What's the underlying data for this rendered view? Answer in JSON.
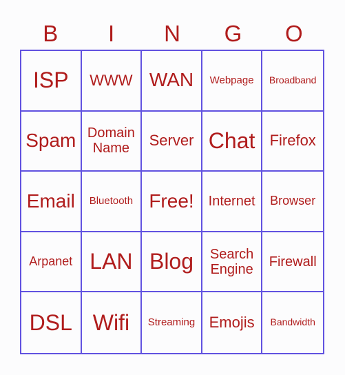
{
  "header": [
    "B",
    "I",
    "N",
    "G",
    "O"
  ],
  "cells": [
    [
      "ISP",
      "WWW",
      "WAN",
      "Webpage",
      "Broadband"
    ],
    [
      "Spam",
      "Domain Name",
      "Server",
      "Chat",
      "Firefox"
    ],
    [
      "Email",
      "Bluetooth",
      "Free!",
      "Internet",
      "Browser"
    ],
    [
      "Arpanet",
      "LAN",
      "Blog",
      "Search Engine",
      "Firewall"
    ],
    [
      "DSL",
      "Wifi",
      "Streaming",
      "Emojis",
      "Bandwidth"
    ]
  ],
  "colors": {
    "text": "#b01c1c",
    "grid": "#6152e0",
    "background": "#fcfcfd"
  }
}
